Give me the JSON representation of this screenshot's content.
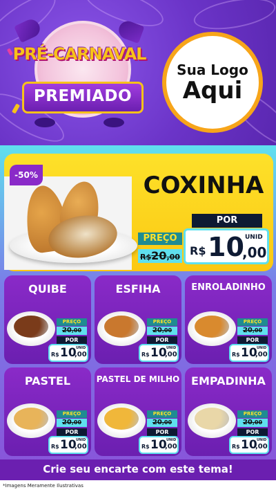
{
  "header": {
    "title_line1": "PRÉ-CARNAVAL",
    "title_line2": "PREMIADO",
    "logo_line1": "Sua Logo",
    "logo_line2": "Aqui"
  },
  "featured": {
    "discount": "-50%",
    "name": "COXINHA",
    "preco_label": "PREÇO",
    "old_currency": "R$",
    "old_int": "20",
    "old_dec": ",00",
    "por_label": "POR",
    "unid_label": "UNID",
    "currency": "R$",
    "price_int": "10",
    "price_dec": ",00"
  },
  "products": [
    {
      "name": "QUIBE",
      "preco_label": "PREÇO",
      "old_int": "20",
      "old_dec": ",00",
      "por_label": "POR",
      "unid_label": "UNID",
      "currency": "R$",
      "price_int": "10",
      "price_dec": ",00"
    },
    {
      "name": "ESFIHA",
      "preco_label": "PREÇO",
      "old_int": "20",
      "old_dec": ",00",
      "por_label": "POR",
      "unid_label": "UNID",
      "currency": "R$",
      "price_int": "10",
      "price_dec": ",00"
    },
    {
      "name": "ENROLADINHO",
      "preco_label": "PREÇO",
      "old_int": "20",
      "old_dec": ",00",
      "por_label": "POR",
      "unid_label": "UNID",
      "currency": "R$",
      "price_int": "10",
      "price_dec": ",00"
    },
    {
      "name": "PASTEL",
      "preco_label": "PREÇO",
      "old_int": "20",
      "old_dec": ",00",
      "por_label": "POR",
      "unid_label": "UNID",
      "currency": "R$",
      "price_int": "10",
      "price_dec": ",00"
    },
    {
      "name": "PASTEL DE MILHO",
      "preco_label": "PREÇO",
      "old_int": "20",
      "old_dec": ",00",
      "por_label": "POR",
      "unid_label": "UNID",
      "currency": "R$",
      "price_int": "10",
      "price_dec": ",00"
    },
    {
      "name": "EMPADINHA",
      "preco_label": "PREÇO",
      "old_int": "20",
      "old_dec": ",00",
      "por_label": "POR",
      "unid_label": "UNID",
      "currency": "R$",
      "price_int": "10",
      "price_dec": ",00"
    }
  ],
  "footer": {
    "cta": "Crie seu encarte com este tema!",
    "disclaimer": "*Imagens Meramente Ilustrativas"
  },
  "colors": {
    "purple": "#6b1fb0",
    "yellow": "#fde12a",
    "cyan": "#5fe0ee",
    "navy": "#0e1a33",
    "orange": "#f7a51a"
  }
}
